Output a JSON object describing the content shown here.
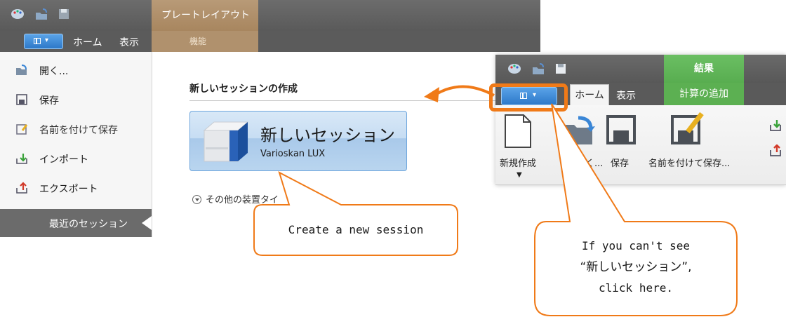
{
  "left_window": {
    "plate_layout_tab": "プレートレイアウト",
    "plate_layout_sub": "機能",
    "menubar": {
      "home": "ホーム",
      "view": "表示"
    },
    "backstage_items": [
      {
        "label": "開く...",
        "icon": "open-folder-icon"
      },
      {
        "label": "保存",
        "icon": "save-icon"
      },
      {
        "label": "名前を付けて保存",
        "icon": "save-as-icon"
      },
      {
        "label": "インポート",
        "icon": "import-icon"
      },
      {
        "label": "エクスポート",
        "icon": "export-icon"
      }
    ],
    "recent_sessions": "最近のセッション",
    "section_title": "新しいセッションの作成",
    "new_session_tile": {
      "title": "新しいセッション",
      "subtitle": "Varioskan LUX"
    },
    "other_types": "その他の装置タイ"
  },
  "right_window": {
    "results_tab": "結果",
    "add_calculation": "計算の追加",
    "home_tab": "ホーム",
    "view_tab": "表示",
    "ribbon": {
      "new": "新規作成",
      "open_partial": "く...",
      "save": "保存",
      "save_as": "名前を付けて保存..."
    }
  },
  "callouts": {
    "create": "Create a new session",
    "hint_line1": "If you can't see",
    "hint_line2": "“新しいセッション”,",
    "hint_line3": "click here."
  },
  "colors": {
    "accent_orange": "#f07a18",
    "plate_layout_brown": "#b0916d",
    "results_green": "#5cb052",
    "file_button_blue": "#2d79c9"
  }
}
